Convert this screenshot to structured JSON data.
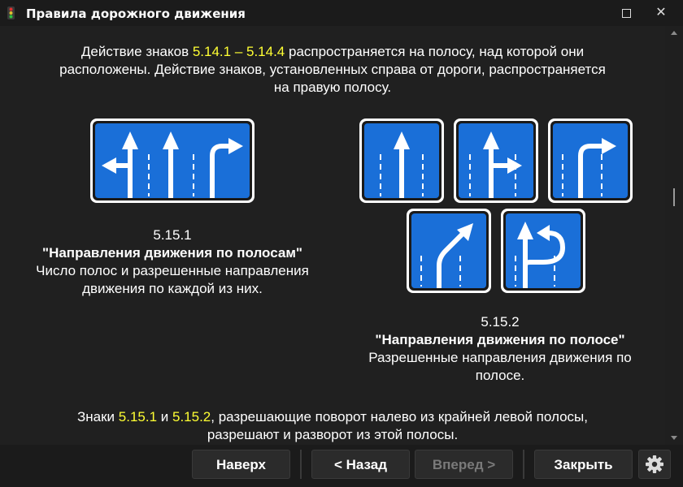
{
  "window": {
    "title": "Правила дорожного движения",
    "icon": "traffic-light-icon"
  },
  "content": {
    "intro": {
      "part1": "Действие знаков ",
      "hl": "5.14.1 – 5.14.4",
      "part2": " распространяется на полосу, над которой они",
      "line2": "расположены. Действие знаков, установленных справа от дороги, распространяется",
      "line3": "на правую полосу."
    },
    "sign1": {
      "number": "5.15.1",
      "name": "\"Направления движения по полосам\"",
      "desc1": "Число полос и разрешенные направления",
      "desc2": "движения по каждой из них."
    },
    "sign2": {
      "number": "5.15.2",
      "name": "\"Направления движения по полосе\"",
      "desc1": "Разрешенные направления движения по",
      "desc2": "полосе."
    },
    "outro": {
      "part1": "Знаки ",
      "hl1": "5.15.1",
      "part2": " и ",
      "hl2": "5.15.2",
      "part3": ", разрешающие поворот налево из крайней левой полосы,",
      "line2": "разрешают и разворот из этой полосы."
    }
  },
  "buttons": {
    "top": "Наверх",
    "back": "< Назад",
    "forward": "Вперед >",
    "close": "Закрыть",
    "settings_icon": "gear-icon"
  },
  "colors": {
    "sign_blue": "#1a6fd8",
    "highlight": "#ffff33",
    "background": "#202020"
  }
}
